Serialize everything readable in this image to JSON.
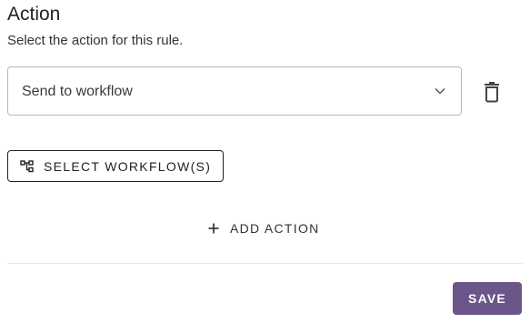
{
  "section": {
    "title": "Action",
    "subtitle": "Select the action for this rule."
  },
  "action_select": {
    "value": "Send to workflow",
    "chevron_icon": "chevron-down-icon"
  },
  "delete": {
    "icon": "trash-icon"
  },
  "workflow_button": {
    "icon": "workflow-icon",
    "label": "SELECT WORKFLOW(S)"
  },
  "add_action": {
    "icon": "plus-icon",
    "label": "ADD ACTION"
  },
  "save_button": {
    "label": "SAVE",
    "color": "#6b5589"
  }
}
